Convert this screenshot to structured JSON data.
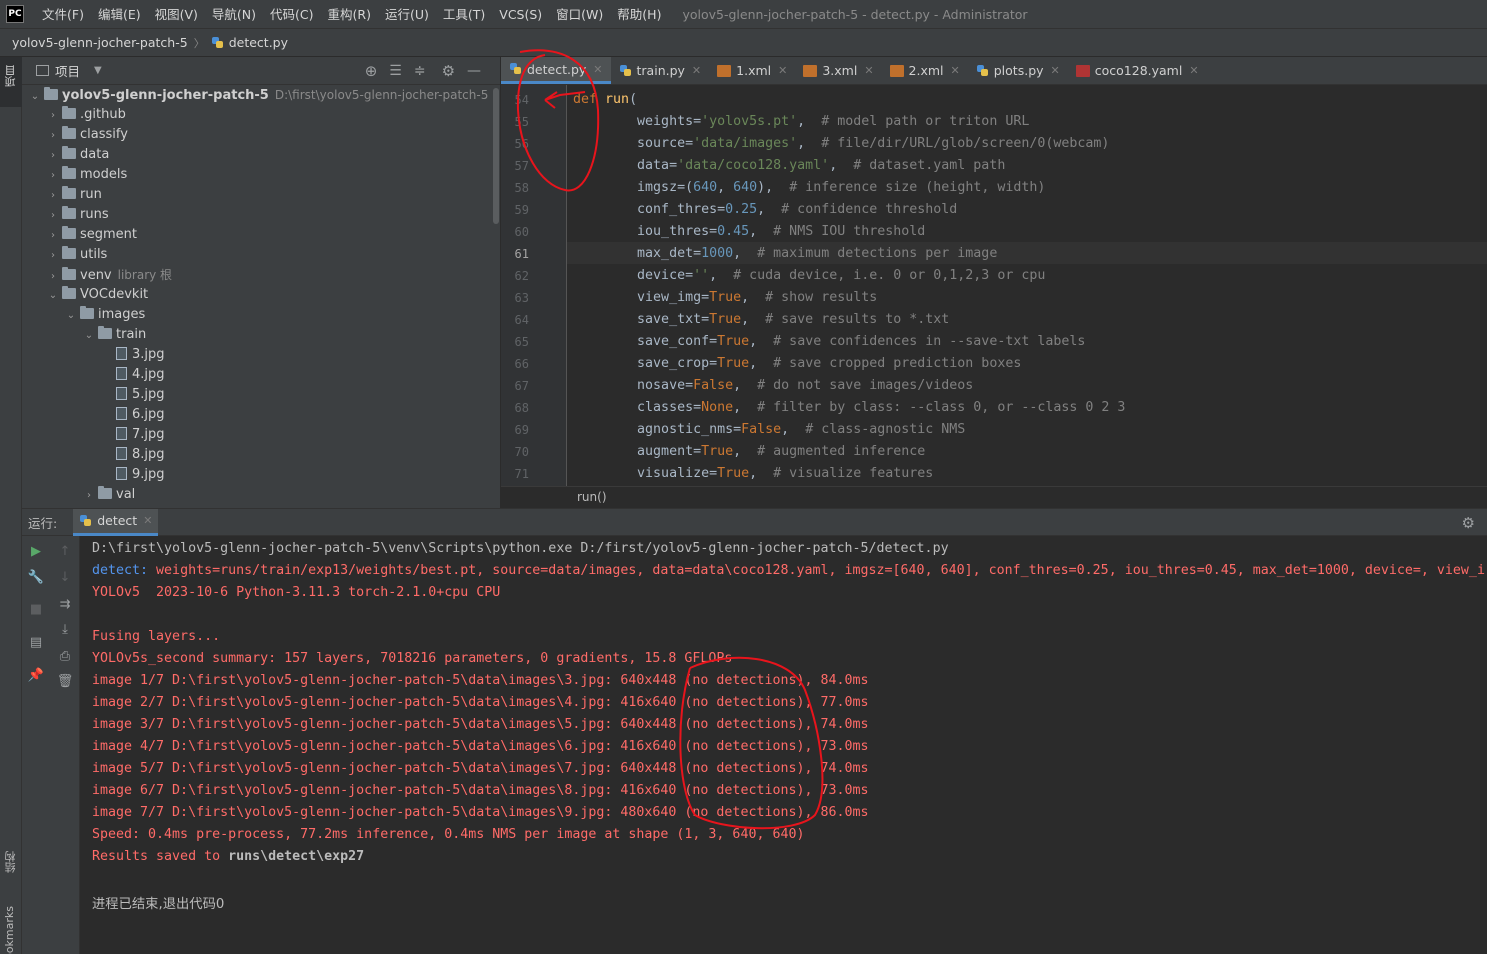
{
  "titlebar": {
    "logo": "PC",
    "menus": [
      "文件(F)",
      "编辑(E)",
      "视图(V)",
      "导航(N)",
      "代码(C)",
      "重构(R)",
      "运行(U)",
      "工具(T)",
      "VCS(S)",
      "窗口(W)",
      "帮助(H)"
    ],
    "window_title": "yolov5-glenn-jocher-patch-5 - detect.py - Administrator"
  },
  "breadcrumb": {
    "project": "yolov5-glenn-jocher-patch-5",
    "separator": "〉",
    "file": "detect.py"
  },
  "left_strip": {
    "top_label": "项目",
    "structure_label": "结构",
    "bookmarks_label": "Bookmarks"
  },
  "project_panel": {
    "title": "项目",
    "tree": [
      {
        "name": "yolov5-glenn-jocher-patch-5",
        "hint": "D:\\first\\yolov5-glenn-jocher-patch-5",
        "depth": 0,
        "expanded": true,
        "type": "folder"
      },
      {
        "name": ".github",
        "depth": 1,
        "expanded": false,
        "type": "folder"
      },
      {
        "name": "classify",
        "depth": 1,
        "expanded": false,
        "type": "folder"
      },
      {
        "name": "data",
        "depth": 1,
        "expanded": false,
        "type": "folder"
      },
      {
        "name": "models",
        "depth": 1,
        "expanded": false,
        "type": "folder"
      },
      {
        "name": "run",
        "depth": 1,
        "expanded": false,
        "type": "folder"
      },
      {
        "name": "runs",
        "depth": 1,
        "expanded": false,
        "type": "folder"
      },
      {
        "name": "segment",
        "depth": 1,
        "expanded": false,
        "type": "folder"
      },
      {
        "name": "utils",
        "depth": 1,
        "expanded": false,
        "type": "folder"
      },
      {
        "name": "venv",
        "hint": "library 根",
        "depth": 1,
        "expanded": false,
        "type": "folder"
      },
      {
        "name": "VOCdevkit",
        "depth": 1,
        "expanded": true,
        "type": "folder"
      },
      {
        "name": "images",
        "depth": 2,
        "expanded": true,
        "type": "folder"
      },
      {
        "name": "train",
        "depth": 3,
        "expanded": true,
        "type": "folder"
      },
      {
        "name": "3.jpg",
        "depth": 4,
        "type": "file"
      },
      {
        "name": "4.jpg",
        "depth": 4,
        "type": "file"
      },
      {
        "name": "5.jpg",
        "depth": 4,
        "type": "file"
      },
      {
        "name": "6.jpg",
        "depth": 4,
        "type": "file"
      },
      {
        "name": "7.jpg",
        "depth": 4,
        "type": "file"
      },
      {
        "name": "8.jpg",
        "depth": 4,
        "type": "file"
      },
      {
        "name": "9.jpg",
        "depth": 4,
        "type": "file"
      },
      {
        "name": "val",
        "depth": 3,
        "expanded": false,
        "type": "folder"
      }
    ]
  },
  "tabs": [
    {
      "label": "detect.py",
      "icon": "python-icon",
      "active": true
    },
    {
      "label": "train.py",
      "icon": "python-icon"
    },
    {
      "label": "1.xml",
      "icon": "xml-icon"
    },
    {
      "label": "3.xml",
      "icon": "xml-icon"
    },
    {
      "label": "2.xml",
      "icon": "xml-icon"
    },
    {
      "label": "plots.py",
      "icon": "python-icon"
    },
    {
      "label": "coco128.yaml",
      "icon": "yaml-icon"
    }
  ],
  "editor": {
    "current_line": 61,
    "lines": [
      {
        "n": 54,
        "tokens": [
          [
            "kw",
            "def "
          ],
          [
            "fn",
            "run"
          ],
          [
            "p",
            "("
          ]
        ]
      },
      {
        "n": 55,
        "tokens": [
          [
            "p",
            "        weights="
          ],
          [
            "str",
            "'yolov5s.pt'"
          ],
          [
            "p",
            ",  "
          ],
          [
            "cm",
            "# model path or triton URL"
          ]
        ]
      },
      {
        "n": 56,
        "tokens": [
          [
            "p",
            "        source="
          ],
          [
            "str",
            "'data/images'"
          ],
          [
            "p",
            ",  "
          ],
          [
            "cm",
            "# file/dir/URL/glob/screen/0(webcam)"
          ]
        ]
      },
      {
        "n": 57,
        "tokens": [
          [
            "p",
            "        data="
          ],
          [
            "str",
            "'data/coco128.yaml'"
          ],
          [
            "p",
            ",  "
          ],
          [
            "cm",
            "# dataset.yaml path"
          ]
        ]
      },
      {
        "n": 58,
        "tokens": [
          [
            "p",
            "        imgsz=("
          ],
          [
            "num",
            "640"
          ],
          [
            "p",
            ", "
          ],
          [
            "num",
            "640"
          ],
          [
            "p",
            "),  "
          ],
          [
            "cm",
            "# inference size (height, width)"
          ]
        ]
      },
      {
        "n": 59,
        "tokens": [
          [
            "p",
            "        conf_thres="
          ],
          [
            "num",
            "0.25"
          ],
          [
            "p",
            ",  "
          ],
          [
            "cm",
            "# confidence threshold"
          ]
        ]
      },
      {
        "n": 60,
        "tokens": [
          [
            "p",
            "        iou_thres="
          ],
          [
            "num",
            "0.45"
          ],
          [
            "p",
            ",  "
          ],
          [
            "cm",
            "# NMS IOU threshold"
          ]
        ]
      },
      {
        "n": 61,
        "tokens": [
          [
            "p",
            "        max_det="
          ],
          [
            "num",
            "1000"
          ],
          [
            "p",
            ",  "
          ],
          [
            "cm",
            "# maximum detections per image"
          ]
        ]
      },
      {
        "n": 62,
        "tokens": [
          [
            "p",
            "        device="
          ],
          [
            "str",
            "''"
          ],
          [
            "p",
            ",  "
          ],
          [
            "cm",
            "# cuda device, i.e. 0 or 0,1,2,3 or cpu"
          ]
        ]
      },
      {
        "n": 63,
        "tokens": [
          [
            "p",
            "        view_img="
          ],
          [
            "kw",
            "True"
          ],
          [
            "p",
            ",  "
          ],
          [
            "cm",
            "# show results"
          ]
        ]
      },
      {
        "n": 64,
        "tokens": [
          [
            "p",
            "        save_txt="
          ],
          [
            "kw",
            "True"
          ],
          [
            "p",
            ",  "
          ],
          [
            "cm",
            "# save results to *.txt"
          ]
        ]
      },
      {
        "n": 65,
        "tokens": [
          [
            "p",
            "        save_conf="
          ],
          [
            "kw",
            "True"
          ],
          [
            "p",
            ",  "
          ],
          [
            "cm",
            "# save confidences in --save-txt labels"
          ]
        ]
      },
      {
        "n": 66,
        "tokens": [
          [
            "p",
            "        save_crop="
          ],
          [
            "kw",
            "True"
          ],
          [
            "p",
            ",  "
          ],
          [
            "cm",
            "# save cropped prediction boxes"
          ]
        ]
      },
      {
        "n": 67,
        "tokens": [
          [
            "p",
            "        nosave="
          ],
          [
            "kw",
            "False"
          ],
          [
            "p",
            ",  "
          ],
          [
            "cm",
            "# do not save images/videos"
          ]
        ]
      },
      {
        "n": 68,
        "tokens": [
          [
            "p",
            "        classes="
          ],
          [
            "kw",
            "None"
          ],
          [
            "p",
            ",  "
          ],
          [
            "cm",
            "# filter by class: --class 0, or --class 0 2 3"
          ]
        ]
      },
      {
        "n": 69,
        "tokens": [
          [
            "p",
            "        agnostic_nms="
          ],
          [
            "kw",
            "False"
          ],
          [
            "p",
            ",  "
          ],
          [
            "cm",
            "# class-agnostic NMS"
          ]
        ]
      },
      {
        "n": 70,
        "tokens": [
          [
            "p",
            "        augment="
          ],
          [
            "kw",
            "True"
          ],
          [
            "p",
            ",  "
          ],
          [
            "cm",
            "# augmented inference"
          ]
        ]
      },
      {
        "n": 71,
        "tokens": [
          [
            "p",
            "        visualize="
          ],
          [
            "kw",
            "True"
          ],
          [
            "p",
            ",  "
          ],
          [
            "cm",
            "# visualize features"
          ]
        ]
      }
    ],
    "footer": "run()"
  },
  "run_panel": {
    "label": "运行:",
    "tab": "detect",
    "console": [
      {
        "style": "norm",
        "text": "D:\\first\\yolov5-glenn-jocher-patch-5\\venv\\Scripts\\python.exe D:/first/yolov5-glenn-jocher-patch-5/detect.py"
      },
      {
        "style": "detect",
        "prefix": "detect: ",
        "text": "weights=runs/train/exp13/weights/best.pt, source=data/images, data=data\\coco128.yaml, imgsz=[640, 640], conf_thres=0.25, iou_thres=0.45, max_det=1000, device=, view_i"
      },
      {
        "style": "err",
        "text": "YOLOv5  2023-10-6 Python-3.11.3 torch-2.1.0+cpu CPU"
      },
      {
        "style": "err",
        "text": ""
      },
      {
        "style": "err",
        "text": "Fusing layers..."
      },
      {
        "style": "err",
        "text": "YOLOv5s_second summary: 157 layers, 7018216 parameters, 0 gradients, 15.8 GFLOPs"
      },
      {
        "style": "err",
        "text": "image 1/7 D:\\first\\yolov5-glenn-jocher-patch-5\\data\\images\\3.jpg: 640x448 (no detections), 84.0ms"
      },
      {
        "style": "err",
        "text": "image 2/7 D:\\first\\yolov5-glenn-jocher-patch-5\\data\\images\\4.jpg: 416x640 (no detections), 77.0ms"
      },
      {
        "style": "err",
        "text": "image 3/7 D:\\first\\yolov5-glenn-jocher-patch-5\\data\\images\\5.jpg: 640x448 (no detections), 74.0ms"
      },
      {
        "style": "err",
        "text": "image 4/7 D:\\first\\yolov5-glenn-jocher-patch-5\\data\\images\\6.jpg: 416x640 (no detections), 73.0ms"
      },
      {
        "style": "err",
        "text": "image 5/7 D:\\first\\yolov5-glenn-jocher-patch-5\\data\\images\\7.jpg: 640x448 (no detections), 74.0ms"
      },
      {
        "style": "err",
        "text": "image 6/7 D:\\first\\yolov5-glenn-jocher-patch-5\\data\\images\\8.jpg: 416x640 (no detections), 73.0ms"
      },
      {
        "style": "err",
        "text": "image 7/7 D:\\first\\yolov5-glenn-jocher-patch-5\\data\\images\\9.jpg: 480x640 (no detections), 86.0ms"
      },
      {
        "style": "err",
        "text": "Speed: 0.4ms pre-process, 77.2ms inference, 0.4ms NMS per image at shape (1, 3, 640, 640)"
      },
      {
        "style": "saved",
        "text": "Results saved to ",
        "bold": "runs\\detect\\exp27"
      },
      {
        "style": "norm",
        "text": ""
      },
      {
        "style": "norm",
        "text": "进程已结束,退出代码0"
      }
    ]
  },
  "colors": {
    "bg": "#2b2b2b",
    "panel": "#3c3f41",
    "keyword": "#cc7832",
    "function": "#ffc66d",
    "string": "#6a8759",
    "number": "#6897bb",
    "comment": "#808080",
    "error_text": "#ff6b68",
    "link": "#5394ec",
    "annotation": "#e8141c"
  }
}
